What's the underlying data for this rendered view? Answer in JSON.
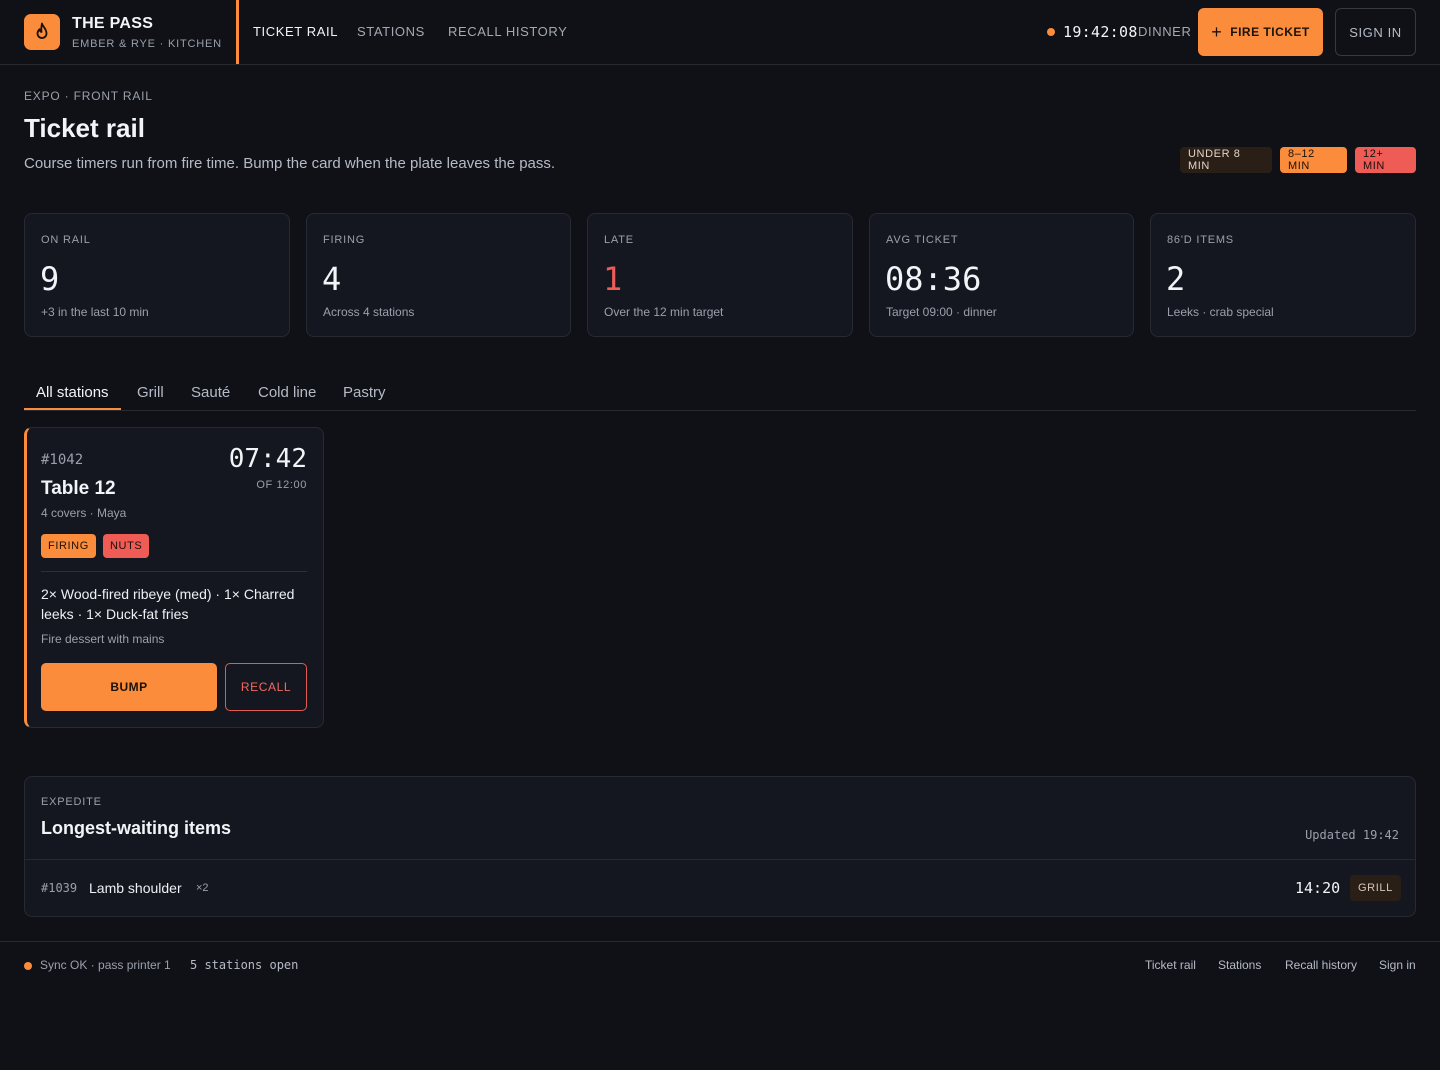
{
  "header": {
    "brand_title": "THE PASS",
    "brand_subtitle": "EMBER & RYE · KITCHEN",
    "nav": [
      "TICKET RAIL",
      "STATIONS",
      "RECALL HISTORY"
    ],
    "clock": "19:42:08",
    "service": "DINNER",
    "fire_button": "FIRE TICKET",
    "sign_in_button": "SIGN IN",
    "accent_color": "#fb8c3c"
  },
  "page": {
    "eyebrow": "EXPO · FRONT RAIL",
    "title": "Ticket rail",
    "description": "Course timers run from fire time. Bump the card when the plate leaves the pass.",
    "legend": [
      "UNDER 8 MIN",
      "8–12 MIN",
      "12+ MIN"
    ]
  },
  "stats": [
    {
      "label": "ON RAIL",
      "value": "9",
      "sub": "+3 in the last 10 min"
    },
    {
      "label": "FIRING",
      "value": "4",
      "sub": "Across 4 stations"
    },
    {
      "label": "LATE",
      "value": "1",
      "sub": "Over the 12 min target"
    },
    {
      "label": "AVG TICKET",
      "value": "08:36",
      "sub": "Target 09:00 · dinner"
    },
    {
      "label": "86'D ITEMS",
      "value": "2",
      "sub": "Leeks · crab special"
    }
  ],
  "tabs": [
    "All stations",
    "Grill",
    "Sauté",
    "Cold line",
    "Pastry"
  ],
  "ticket": {
    "number": "#1042",
    "timer": "07:42",
    "target": "OF 12:00",
    "table": "Table 12",
    "covers": "4 covers · Maya",
    "badges": [
      "FIRING",
      "NUTS"
    ],
    "items": "2× Wood-fired ribeye (med) · 1× Charred leeks · 1× Duck-fat fries",
    "note": "Fire dessert with mains",
    "bump_button": "BUMP",
    "recall_button": "RECALL"
  },
  "expedite": {
    "eyebrow": "EXPEDITE",
    "title": "Longest-waiting items",
    "updated": "Updated 19:42",
    "rows": [
      {
        "ticket": "#1039",
        "item": "Lamb shoulder",
        "qty": "×2",
        "time": "14:20",
        "station": "GRILL"
      }
    ]
  },
  "footer": {
    "sync": "Sync OK · pass printer 1",
    "stations_open": "5 stations open",
    "links": [
      "Ticket rail",
      "Stations",
      "Recall history",
      "Sign in"
    ]
  },
  "icons": {
    "brand": "flame-icon",
    "fire_button": "plus-icon",
    "status": "status-dot-icon"
  }
}
